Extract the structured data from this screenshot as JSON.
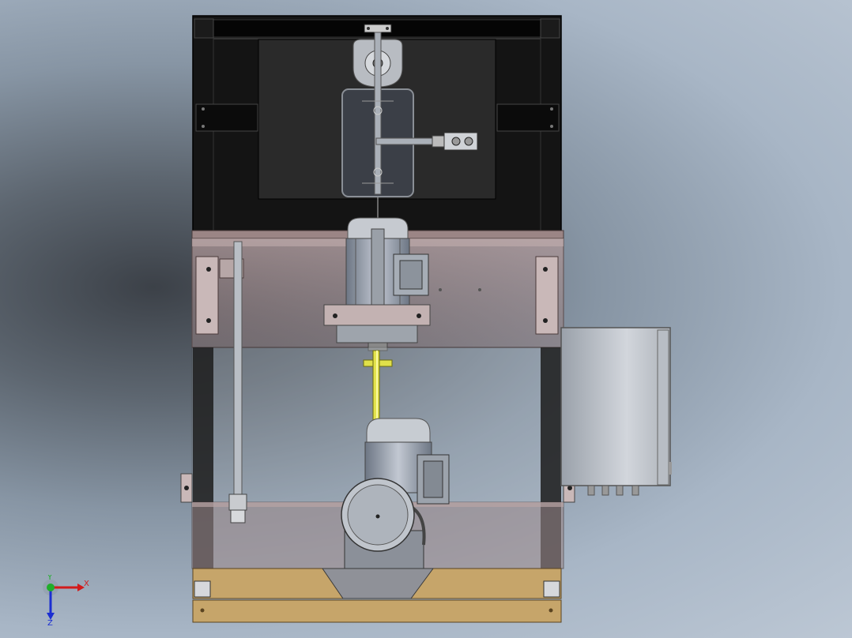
{
  "view": {
    "background_gradient": [
      "#3c4148",
      "#8795a4",
      "#bcc7d4"
    ]
  },
  "triad": {
    "x_label": "X",
    "y_label": "Y",
    "z_label": "Z",
    "x_color": "#d21b1b",
    "y_color": "#1fae2a",
    "z_color": "#1b2ed2"
  },
  "colors": {
    "frame": "#111111",
    "panel": "#2b2b2b",
    "sheet_metal": "#b49696",
    "shaft": "#d9d94a",
    "base_wood": "#c7a86c",
    "motor": "#8d98a8",
    "enclosure": "#c9cdd3"
  }
}
